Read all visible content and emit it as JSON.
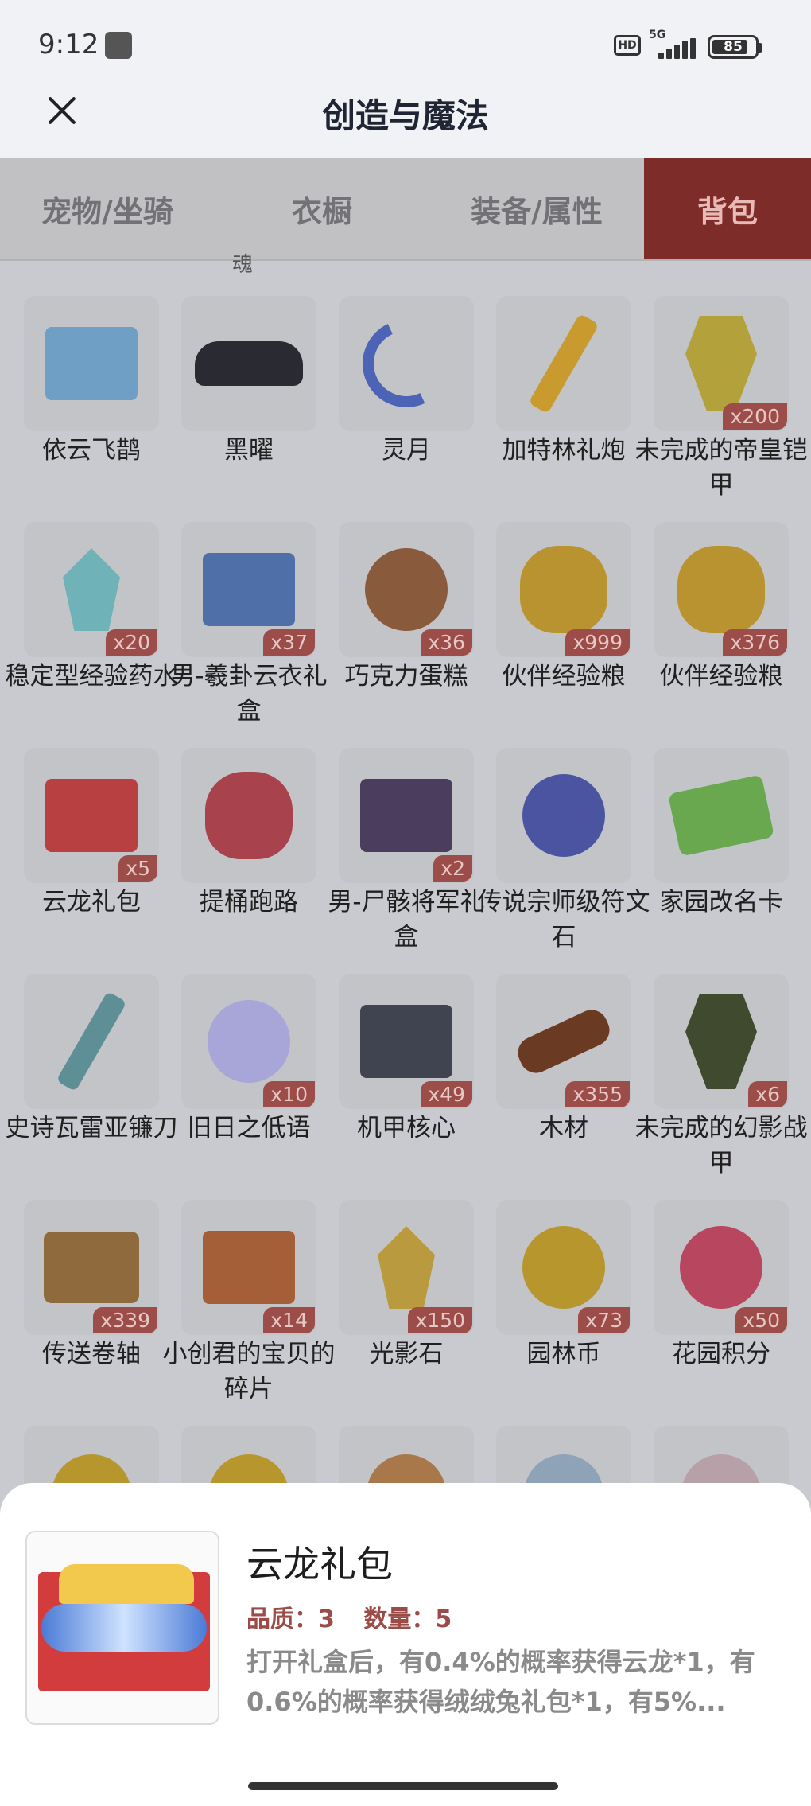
{
  "status_bar": {
    "time": "9:12",
    "hd": "HD",
    "network": "5G",
    "battery": "85"
  },
  "header": {
    "title": "创造与魔法"
  },
  "tabs": [
    {
      "label": "宠物/坐骑",
      "active": false
    },
    {
      "label": "衣橱",
      "active": false
    },
    {
      "label": "装备/属性",
      "active": false
    },
    {
      "label": "背包",
      "active": true
    }
  ],
  "stub_text": "魂",
  "items": [
    {
      "name": "依云飞鹊",
      "qty": "",
      "icon": "drone-icon",
      "color": "#6f9fc4"
    },
    {
      "name": "黑曜",
      "qty": "",
      "icon": "car-icon",
      "color": "#2a2a33"
    },
    {
      "name": "灵月",
      "qty": "",
      "icon": "moon-icon",
      "color": "#4d63b5"
    },
    {
      "name": "加特林礼炮",
      "qty": "",
      "icon": "cannon-icon",
      "color": "#c99a2e"
    },
    {
      "name": "未完成的帝皇铠甲",
      "qty": "x200",
      "icon": "armor-icon",
      "color": "#b3a23c"
    },
    {
      "name": "稳定型经验药水",
      "qty": "x20",
      "icon": "potion-icon",
      "color": "#6fb3b9"
    },
    {
      "name": "男-羲卦云衣礼盒",
      "qty": "x37",
      "icon": "giftbox-icon",
      "color": "#4e6fa8"
    },
    {
      "name": "巧克力蛋糕",
      "qty": "x36",
      "icon": "cake-icon",
      "color": "#8a5a3c"
    },
    {
      "name": "伙伴经验粮",
      "qty": "x999",
      "icon": "bag-icon",
      "color": "#b8932f"
    },
    {
      "name": "伙伴经验粮",
      "qty": "x376",
      "icon": "bag-icon",
      "color": "#b8932f"
    },
    {
      "name": "云龙礼包",
      "qty": "x5",
      "icon": "dragon-box-icon",
      "color": "#b84040"
    },
    {
      "name": "提桶跑路",
      "qty": "",
      "icon": "bucket-icon",
      "color": "#a8434e"
    },
    {
      "name": "男-尸骸将军礼盒",
      "qty": "x2",
      "icon": "giftbox-icon",
      "color": "#4a3d5e"
    },
    {
      "name": "传说宗师级符文石",
      "qty": "",
      "icon": "rune-icon",
      "color": "#4b54a0"
    },
    {
      "name": "家园改名卡",
      "qty": "",
      "icon": "card-icon",
      "color": "#6aa84f"
    },
    {
      "name": "史诗瓦雷亚镰刀",
      "qty": "",
      "icon": "scythe-icon",
      "color": "#5f8f96"
    },
    {
      "name": "旧日之低语",
      "qty": "x10",
      "icon": "orb-icon",
      "color": "#a8a5d8"
    },
    {
      "name": "机甲核心",
      "qty": "x49",
      "icon": "core-icon",
      "color": "#3f4450"
    },
    {
      "name": "木材",
      "qty": "x355",
      "icon": "log-icon",
      "color": "#6b3a22"
    },
    {
      "name": "未完成的幻影战甲",
      "qty": "x6",
      "icon": "armor-icon",
      "color": "#3f4a2e"
    },
    {
      "name": "传送卷轴",
      "qty": "x339",
      "icon": "scroll-icon",
      "color": "#8f6a3c"
    },
    {
      "name": "小创君的宝贝的碎片",
      "qty": "x14",
      "icon": "puzzle-icon",
      "color": "#a55f38"
    },
    {
      "name": "光影石",
      "qty": "x150",
      "icon": "crystal-icon",
      "color": "#b99a3e"
    },
    {
      "name": "园林币",
      "qty": "x73",
      "icon": "coin-icon",
      "color": "#b8962e"
    },
    {
      "name": "花园积分",
      "qty": "x50",
      "icon": "flower-icon",
      "color": "#b8465e"
    }
  ],
  "detail": {
    "name": "云龙礼包",
    "quality": "品质：3",
    "count": "数量：5",
    "description": "打开礼盒后，有0.4%的概率获得云龙*1，有0.6%的概率获得绒绒兔礼包*1，有5%..."
  }
}
